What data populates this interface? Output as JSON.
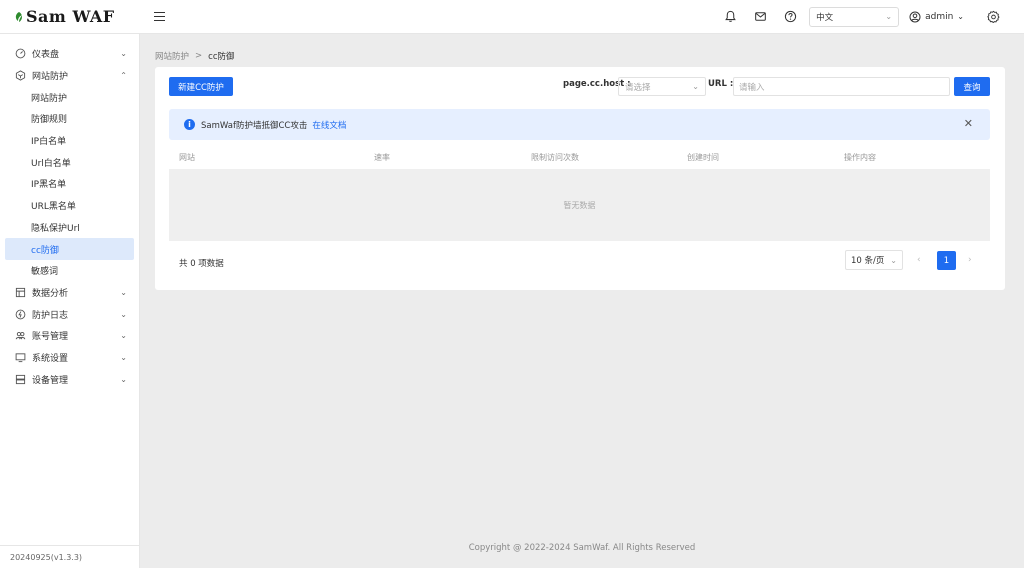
{
  "header": {
    "logo_sam": "Sam",
    "logo_waf": "WAF",
    "language": "中文",
    "user": "admin"
  },
  "sidebar": {
    "items": [
      {
        "label": "仪表盘",
        "icon": "dashboard-icon"
      },
      {
        "label": "网站防护",
        "icon": "shield-icon"
      },
      {
        "label": "数据分析",
        "icon": "chart-icon"
      },
      {
        "label": "防护日志",
        "icon": "log-icon"
      },
      {
        "label": "账号管理",
        "icon": "users-icon"
      },
      {
        "label": "系统设置",
        "icon": "system-icon"
      },
      {
        "label": "设备管理",
        "icon": "server-icon"
      }
    ],
    "sub_items": [
      "网站防护",
      "防御规则",
      "IP白名单",
      "Url白名单",
      "IP黑名单",
      "URL黑名单",
      "隐私保护Url",
      "cc防御",
      "敏感词"
    ],
    "version": "20240925(v1.3.3)"
  },
  "breadcrumb": {
    "parent": "网站防护",
    "separator": ">",
    "current": "cc防御"
  },
  "toolbar": {
    "new_button": "新建CC防护",
    "host_label": "page.cc.host :",
    "host_placeholder": "请选择",
    "url_label": "URL :",
    "url_placeholder": "请输入",
    "query_button": "查询"
  },
  "alert": {
    "message": "SamWaf防护墙抵御CC攻击",
    "link": "在线文档"
  },
  "table": {
    "columns": [
      "网站",
      "速率",
      "限制访问次数",
      "创建时间",
      "操作内容"
    ],
    "empty": "暂无数据"
  },
  "pagination": {
    "total": "共 0 项数据",
    "page_size": "10 条/页",
    "current_page": "1"
  },
  "footer": "Copyright @ 2022-2024 SamWaf. All Rights Reserved",
  "colors": {
    "primary": "#1f6cf0",
    "alert_bg": "#e6efff",
    "active_bg": "#dde9fb"
  }
}
